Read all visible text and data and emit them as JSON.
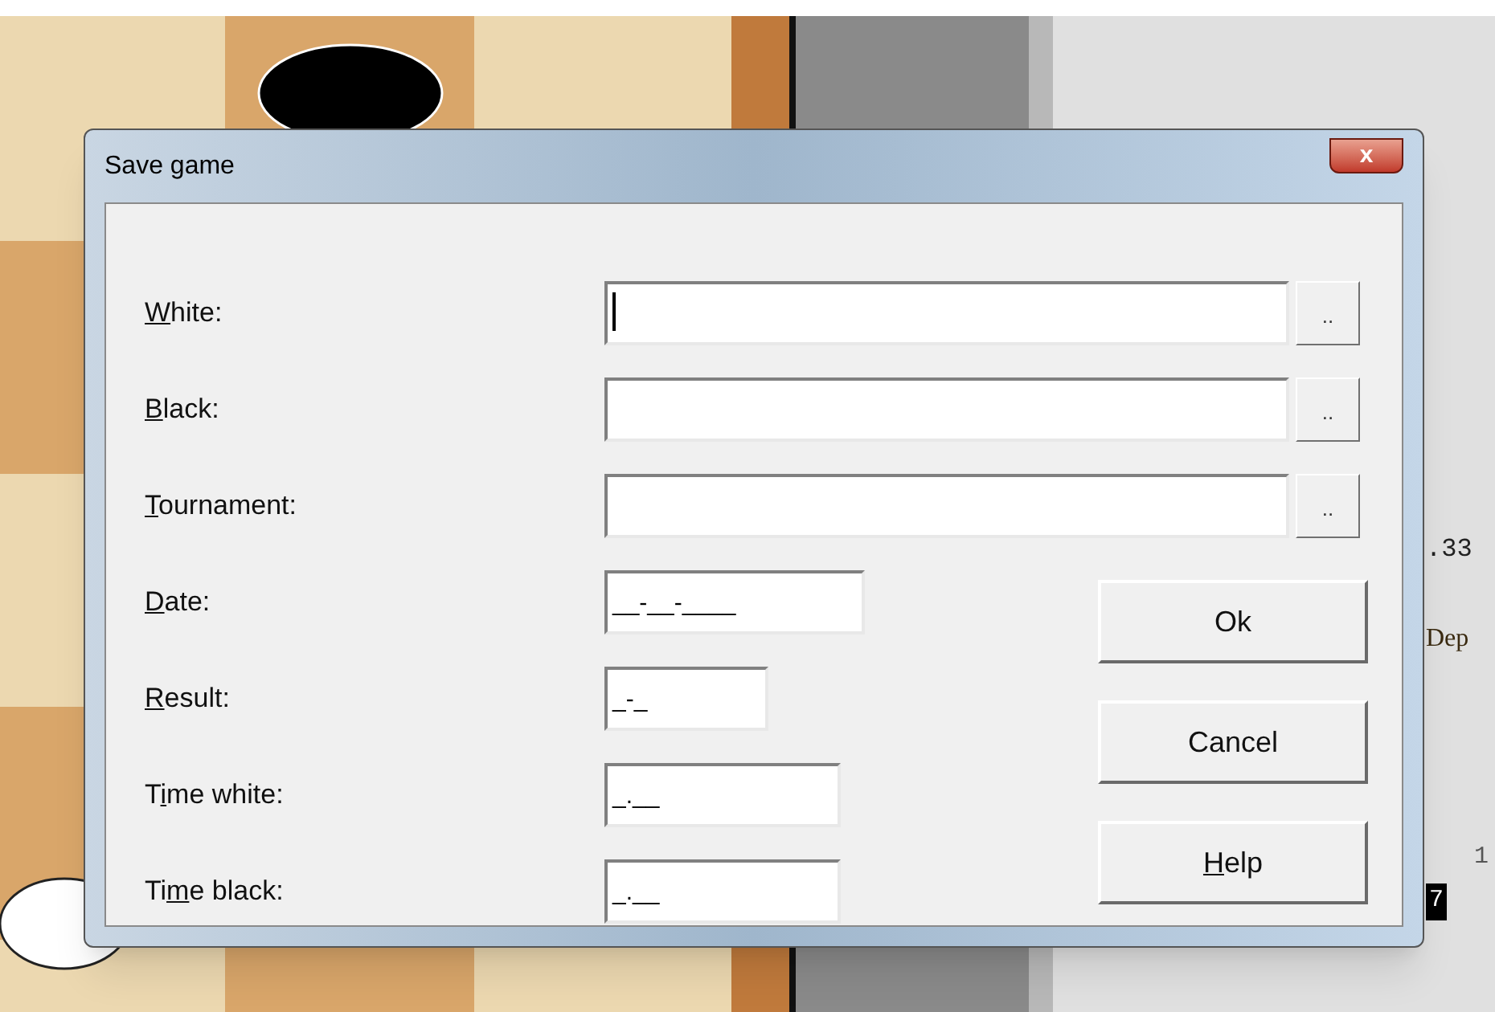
{
  "background": {
    "side_panel": {
      "texts": [
        ".33",
        "Dep",
        "1",
        "7"
      ]
    }
  },
  "dialog": {
    "title": "Save game",
    "close_symbol": "x",
    "fields": [
      {
        "label": {
          "key": "W",
          "post": "hite:"
        },
        "focused": true,
        "browse": ".."
      },
      {
        "label": {
          "key": "B",
          "post": "lack:"
        },
        "focused": false,
        "browse": ".."
      },
      {
        "label": {
          "key": "T",
          "post": "ournament:"
        },
        "focused": false,
        "browse": ".."
      },
      {
        "label": {
          "key": "D",
          "post": "ate:"
        },
        "value": "__-__-____",
        "focused": false
      },
      {
        "label": {
          "key": "R",
          "post": "esult:"
        },
        "value": "_-_",
        "focused": false
      },
      {
        "label": {
          "pre": "T",
          "key": "i",
          "post": "me white:"
        },
        "value": "_.__",
        "focused": false
      },
      {
        "label": {
          "pre": "Ti",
          "key": "m",
          "post": "e black:"
        },
        "value": "_.__",
        "focused": false
      }
    ],
    "buttons": [
      {
        "label": {
          "pre": "Ok"
        }
      },
      {
        "label": {
          "pre": "Cancel"
        }
      },
      {
        "label": {
          "key": "H",
          "post": "elp"
        }
      }
    ]
  }
}
